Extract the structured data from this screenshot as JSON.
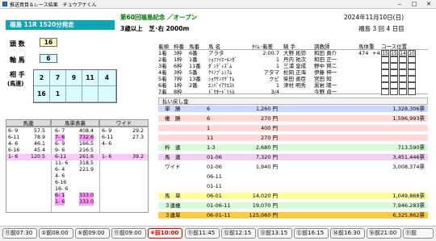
{
  "window": {
    "title": "推送買目＆レース結果　チュウアナくん",
    "minimize": "‒",
    "maximize": "□",
    "close": "✕"
  },
  "race": {
    "banner": "福島 11R  1520分発走",
    "name_line": "第60回福島記念 ／オープン",
    "cond_line": "3歳以上　芝･右 2000m",
    "date": "2024年11月10日(日)",
    "meeting": "福島 3 回 4 日目"
  },
  "bet": {
    "count_label": "頭 数",
    "count_value": "16",
    "axis_label": "軸 馬",
    "axis_value": "6",
    "partner_label_1": "相 手",
    "partner_label_2": "(馬連)",
    "partners": [
      "2",
      "7",
      "9",
      "11",
      "4",
      "16",
      "1",
      "",
      "",
      ""
    ]
  },
  "odds": {
    "headers": [
      "馬連",
      "馬単表裏",
      "ワイド"
    ],
    "rows": [
      {
        "c1": "6- 9",
        "c2": "57.5",
        "c3": "6- 7",
        "c4": "408.4",
        "c5": "6- 9",
        "c6": "29.2",
        "hl": "none"
      },
      {
        "c1": "6-11",
        "c2": "78.9",
        "c3": "7- 6",
        "c4": "732.6",
        "c5": "6-11",
        "c6": "27.3",
        "hl": "none"
      },
      {
        "c1": "4- 6",
        "c2": "46.1",
        "c3": "6- 9",
        "c4": "166.5",
        "c5": "4- 6",
        "c6": "",
        "hl": "none"
      },
      {
        "c1": "6-16",
        "c2": "45.4",
        "c3": "9- 6",
        "c4": "216.5",
        "c5": "",
        "c6": "",
        "hl": "none"
      },
      {
        "c1": "1- 6",
        "c2": "120.5",
        "c3": "6-11",
        "c4": "261.6",
        "c5": "1- 6",
        "c6": "39.2",
        "hl": "pink"
      },
      {
        "c1": "",
        "c2": "",
        "c3": "11- 6",
        "c4": "318.5",
        "c5": "",
        "c6": "",
        "hl": "none"
      },
      {
        "c1": "",
        "c2": "",
        "c3": "6- 4",
        "c4": "221.9",
        "c5": "",
        "c6": "",
        "hl": "none"
      },
      {
        "c1": "",
        "c2": "",
        "c3": "4- 6",
        "c4": "",
        "c5": "",
        "c6": "",
        "hl": "none"
      },
      {
        "c1": "",
        "c2": "",
        "c3": "6-16",
        "c4": "",
        "c5": "",
        "c6": "",
        "hl": "none"
      },
      {
        "c1": "",
        "c2": "",
        "c3": "16- 6",
        "c4": "",
        "c5": "",
        "c6": "",
        "hl": "none"
      },
      {
        "c1": "",
        "c2": "",
        "c3": "6- 1",
        "c4": "333.0",
        "c5": "",
        "c6": "",
        "hl": "none"
      },
      {
        "c1": "",
        "c2": "",
        "c3": "1- 6",
        "c4": "333.0",
        "c5": "",
        "c6": "",
        "hl": "none"
      }
    ]
  },
  "horses": {
    "headers": [
      "着順",
      "枠番",
      "馬番",
      "馬 名",
      "ﾀｲﾑ･着差",
      "騎 手",
      "調教師",
      "馬体重",
      "コース位置"
    ],
    "rows": [
      {
        "rank": "1着",
        "waku": "3枠",
        "num": "6番",
        "name": "アラタ",
        "time": "2:00.7",
        "jockey": "大野 拓弥",
        "trainer": "和田 勇介",
        "weight": "474",
        "diff": "+4",
        "pos": [
          "15",
          "15",
          "14",
          "10"
        ]
      },
      {
        "rank": "2着",
        "waku": "1枠",
        "num": "1番",
        "name": "ｼｮﾌｧｲｴｰﾙﾝﾀﾞ",
        "time": "1",
        "jockey": "丹内 祐次",
        "trainer": "和田 正一",
        "weight": "",
        "diff": "",
        "pos": [
          "",
          "",
          "",
          ""
        ]
      },
      {
        "rank": "3着",
        "waku": "6枠",
        "num": "11番",
        "name": "ﾀﾞﾝﾃﾞｨｽﾞﾑ",
        "time": "1",
        "jockey": "三浦 皇成",
        "trainer": "野中 賢二",
        "weight": "",
        "diff": "",
        "pos": [
          "",
          "",
          "",
          ""
        ]
      },
      {
        "rank": "4着",
        "waku": "3枠",
        "num": "5番",
        "name": "ｸﾘﾉﾌﾟﾚﾐｱﾑ",
        "time": "アタマ",
        "jockey": "松岡 正海",
        "trainer": "伊藤 伸一",
        "weight": "",
        "diff": "",
        "pos": [
          "",
          "",
          "",
          ""
        ]
      },
      {
        "rank": "5着",
        "waku": "7枠",
        "num": "13番",
        "name": "ｼｮｳｹﾝﾏｸﾞﾅﾑ",
        "time": "クビ",
        "jockey": "柴田 善臣",
        "trainer": "宮田 知",
        "weight": "",
        "diff": "",
        "pos": [
          "",
          "",
          "",
          ""
        ]
      },
      {
        "rank": "6着",
        "waku": "1枠",
        "num": "2番",
        "name": "ｴﾝﾊﾟｲｱｸｴｽﾄ",
        "time": "1",
        "jockey": "津村 明秀",
        "trainer": "黒岩 陽一",
        "weight": "",
        "diff": "",
        "pos": [
          "",
          "",
          "",
          ""
        ]
      },
      {
        "rank": "7着",
        "waku": "8枠",
        "num": "",
        "name": "ﾄﾞｸﾀｰﾄﾞﾘﾄﾙ",
        "time": "3/4",
        "jockey": "",
        "trainer": "今野 貞一",
        "weight": "",
        "diff": "",
        "pos": [
          "",
          "",
          "",
          ""
        ]
      }
    ]
  },
  "payout": {
    "title": "払い戻し金",
    "rows": [
      {
        "type": "単　勝",
        "combo": "6",
        "pay": "1,260 円",
        "votes": "1,328,306票",
        "color": "#ccd8ff"
      },
      {
        "type": "複　勝",
        "combo": "6",
        "pay": "270 円",
        "votes": "1,596,993票",
        "color": "#ffd8d8"
      },
      {
        "type": "",
        "combo": "1",
        "pay": "400 円",
        "votes": "",
        "color": "#ffd8d8"
      },
      {
        "type": "",
        "combo": "11",
        "pay": "270 円",
        "votes": "",
        "color": "#ffd8d8"
      },
      {
        "type": "枠　連",
        "combo": "1-3",
        "pay": "2,680 円",
        "votes": "713,590票",
        "color": "#d8fcd8"
      },
      {
        "type": "馬　連",
        "combo": "01-06",
        "pay": "7,320 円",
        "votes": "3,451,446票",
        "color": "#f4d0f4"
      },
      {
        "type": "ワイド",
        "combo": "01-06",
        "pay": "1,940 円",
        "votes": "3,008,374票",
        "color": "#ffffff"
      },
      {
        "type": "",
        "combo": "06-11",
        "pay": "",
        "votes": "",
        "color": "#ffffff"
      },
      {
        "type": "",
        "combo": "01-11",
        "pay": "",
        "votes": "",
        "color": "#ffffff"
      },
      {
        "type": "馬　単",
        "combo": "06-01",
        "pay": "14,020 円",
        "votes": "1,049,868票",
        "color": "#ffff9a"
      },
      {
        "type": "３連複",
        "combo": "01-06-11",
        "pay": "19,070 円",
        "votes": "7,946,283票",
        "color": "#d8fcd8"
      },
      {
        "type": "３連単",
        "combo": "06-01-11",
        "pay": "125,060 円",
        "votes": "6,325,862票",
        "color": "#ffcc40"
      }
    ]
  },
  "tabs": [
    "⑪前07:30",
    "②前08:00",
    "⑤前09:00",
    "⑪前09:00",
    "⑥前10:00",
    "⑪前11:45",
    "⑫前12:15",
    "⑬前13:15",
    "⑫前16:15",
    "⑭前16:30",
    "⑯前21:00",
    "⑪前"
  ],
  "active_tab": 4
}
